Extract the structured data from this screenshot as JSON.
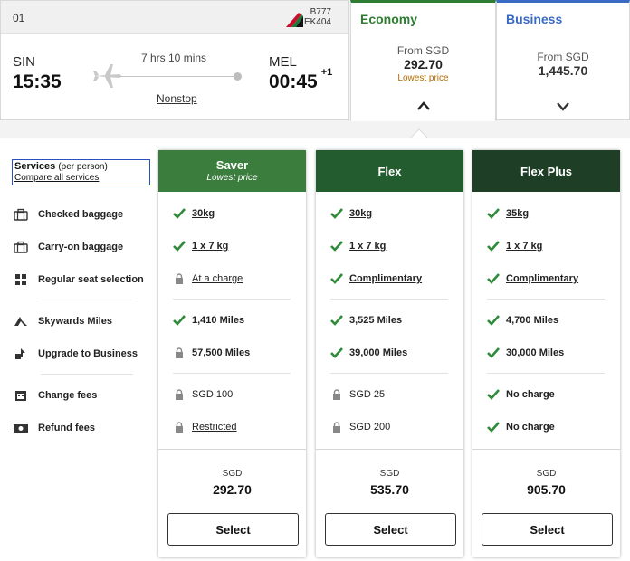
{
  "flight": {
    "index": "01",
    "aircraft": "B777",
    "flight_no": "EK404",
    "origin": "SIN",
    "dep_time": "15:35",
    "destination": "MEL",
    "arr_time": "00:45",
    "day_offset": "+1",
    "duration": "7 hrs 10 mins",
    "stops": "Nonstop"
  },
  "cabins": {
    "economy": {
      "name": "Economy",
      "from": "From SGD",
      "price": "292.70",
      "note": "Lowest price"
    },
    "business": {
      "name": "Business",
      "from": "From SGD",
      "price": "1,445.70"
    }
  },
  "services_header": {
    "title": "Services",
    "per": "(per person)",
    "compare": "Compare all services"
  },
  "services": [
    {
      "label": "Checked baggage",
      "icon": "suitcase-icon"
    },
    {
      "label": "Carry-on baggage",
      "icon": "carry-on-icon"
    },
    {
      "label": "Regular seat selection",
      "icon": "seat-icon"
    },
    {
      "label": "Skywards Miles",
      "icon": "skywards-icon"
    },
    {
      "label": "Upgrade to Business",
      "icon": "upgrade-icon"
    },
    {
      "label": "Change fees",
      "icon": "calendar-icon"
    },
    {
      "label": "Refund fees",
      "icon": "refund-icon"
    }
  ],
  "fares": [
    {
      "name": "Saver",
      "subtitle": "Lowest price",
      "values": [
        "30kg",
        "1 x 7 kg",
        "At a charge",
        "1,410 Miles",
        "57,500 Miles",
        "SGD 100",
        "Restricted"
      ],
      "currency": "SGD",
      "price": "292.70",
      "button": "Select"
    },
    {
      "name": "Flex",
      "subtitle": "",
      "values": [
        "30kg",
        "1 x 7 kg",
        "Complimentary",
        "3,525 Miles",
        "39,000 Miles",
        "SGD 25",
        "SGD 200"
      ],
      "currency": "SGD",
      "price": "535.70",
      "button": "Select"
    },
    {
      "name": "Flex Plus",
      "subtitle": "",
      "values": [
        "35kg",
        "1 x 7 kg",
        "Complimentary",
        "4,700 Miles",
        "30,000 Miles",
        "No charge",
        "No charge"
      ],
      "currency": "SGD",
      "price": "905.70",
      "button": "Select"
    }
  ],
  "colors": {
    "check": "#2e8b3a",
    "economy": "#2e7d32",
    "business": "#3a6bc4",
    "lowest_price": "#b36b00"
  }
}
